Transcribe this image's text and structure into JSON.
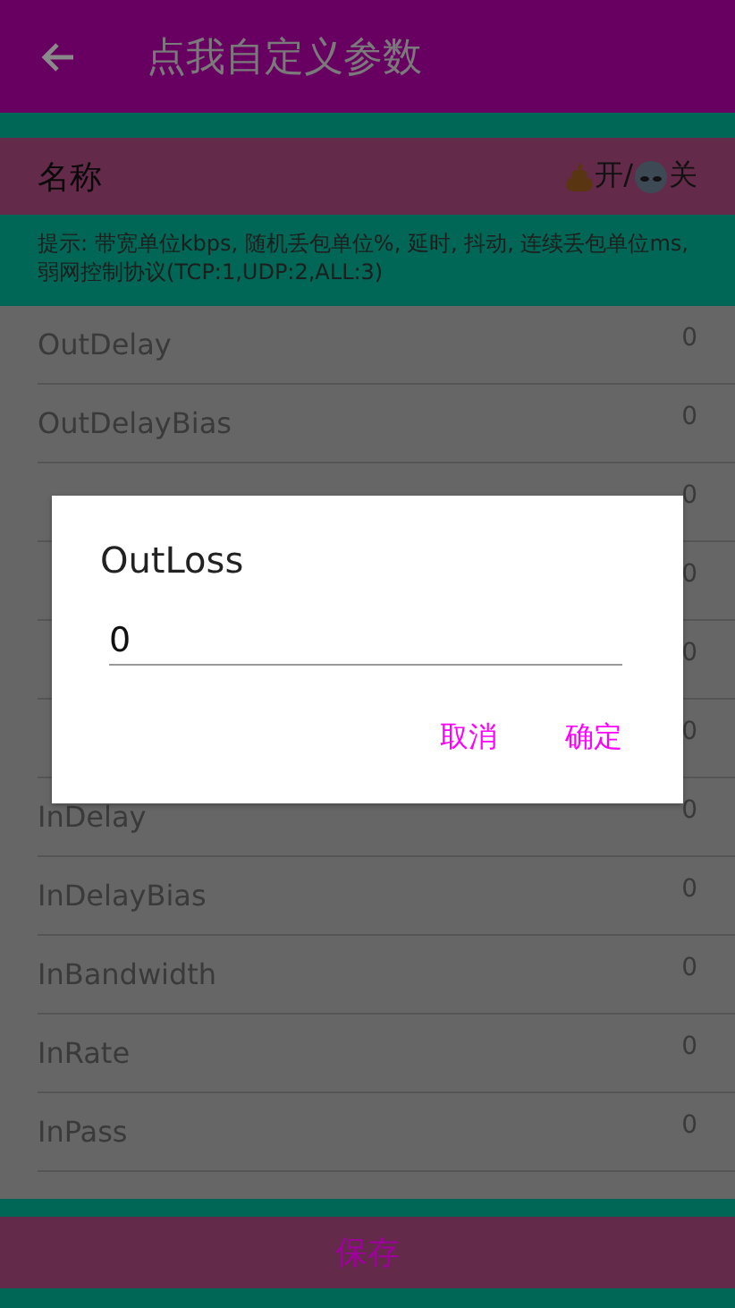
{
  "app_bar": {
    "back_icon": true,
    "title": "点我自定义参数"
  },
  "header": {
    "name_label": "名称",
    "on_label": "开/",
    "off_label": "关"
  },
  "hint": "提示: 带宽单位kbps, 随机丢包单位%, 延时, 抖动, 连续丢包单位ms, 弱网控制协议(TCP:1,UDP:2,ALL:3)",
  "rows": [
    {
      "name": "OutDelay",
      "value": "0"
    },
    {
      "name": "OutDelayBias",
      "value": "0"
    },
    {
      "value": "0"
    },
    {
      "value": "0"
    },
    {
      "value": "0"
    },
    {
      "value": "0"
    },
    {
      "name": "InDelay",
      "value": "0"
    },
    {
      "name": "InDelayBias",
      "value": "0"
    },
    {
      "name": "InBandwidth",
      "value": "0"
    },
    {
      "name": "InRate",
      "value": "0"
    },
    {
      "name": "InPass",
      "value": "0"
    }
  ],
  "save_button": "保存",
  "dialog": {
    "title": "OutLoss",
    "value": "0",
    "buttons": [
      "取消",
      "确定"
    ]
  }
}
